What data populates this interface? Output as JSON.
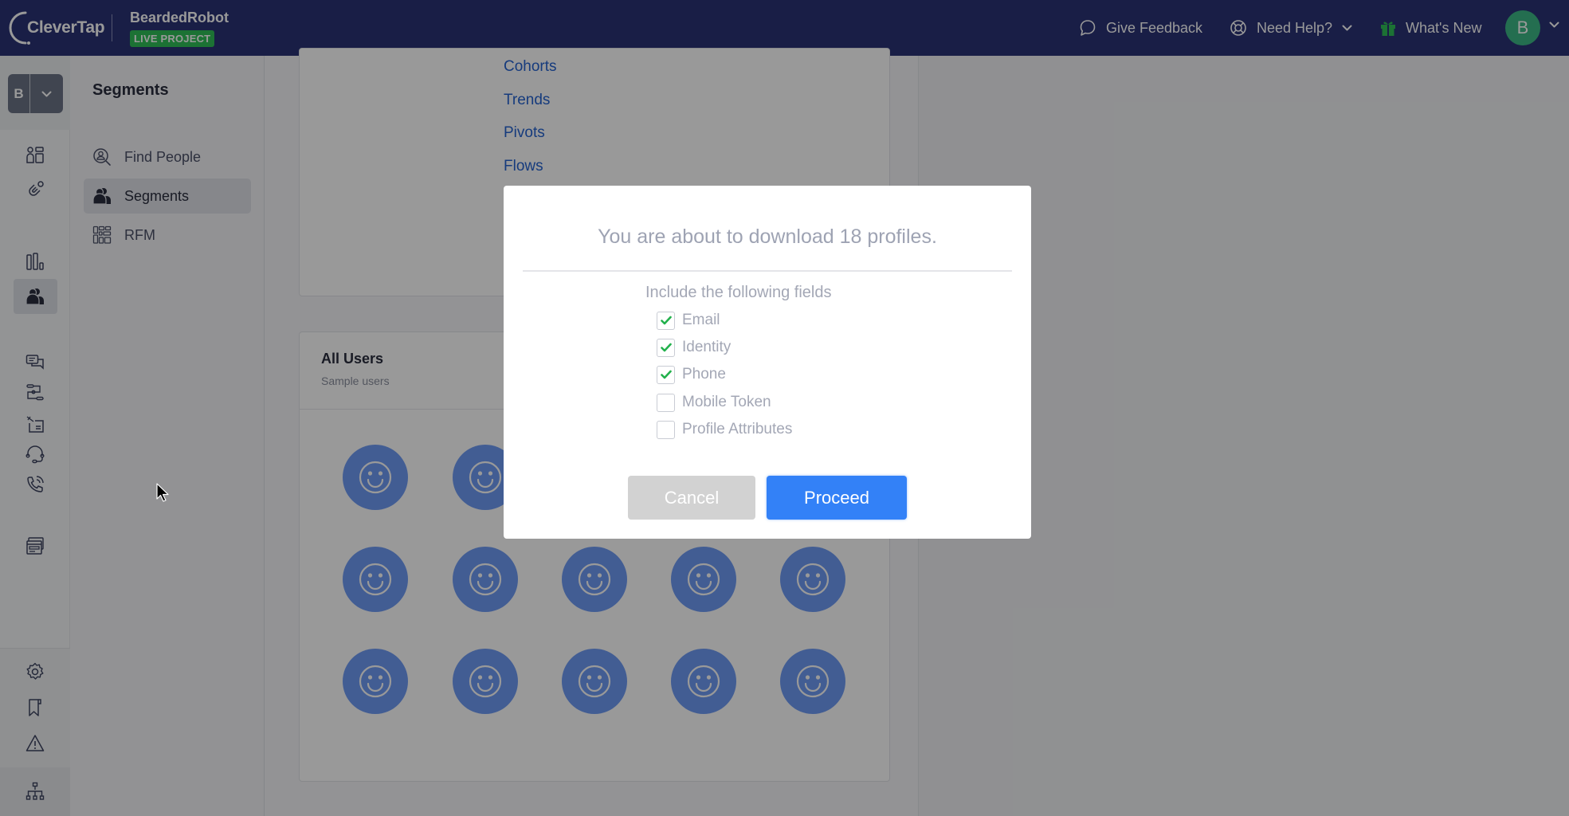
{
  "header": {
    "logo_text": "CleverTap",
    "project_name": "BeardedRobot",
    "project_badge": "LIVE PROJECT",
    "give_feedback": "Give Feedback",
    "need_help": "Need Help?",
    "whats_new": "What's New",
    "user_initial": "B"
  },
  "rail": {
    "project_initial": "B",
    "icons": [
      "dashboard-icon",
      "magnet-icon",
      "analytics-icon",
      "segments-icon",
      "messages-icon",
      "journeys-icon",
      "campaigns-icon",
      "support-icon",
      "calls-icon",
      "web-icon",
      "settings-icon",
      "bookmark-icon",
      "alert-icon",
      "hierarchy-icon"
    ],
    "active": "segments-icon"
  },
  "subnav": {
    "title": "Segments",
    "items": [
      {
        "label": "Find People",
        "icon": "find-people-icon",
        "active": false
      },
      {
        "label": "Segments",
        "icon": "segments-icon",
        "active": true
      },
      {
        "label": "RFM",
        "icon": "rfm-icon",
        "active": false
      }
    ]
  },
  "main": {
    "links": [
      "Cohorts",
      "Trends",
      "Pivots",
      "Flows"
    ],
    "users_card": {
      "title": "All Users",
      "subtitle": "Sample users",
      "avatar_count_visible": 15
    }
  },
  "modal": {
    "title": "You are about to download 18 profiles.",
    "subtitle": "Include the following fields",
    "fields": [
      {
        "label": "Email",
        "checked": true
      },
      {
        "label": "Identity",
        "checked": true
      },
      {
        "label": "Phone",
        "checked": true
      },
      {
        "label": "Mobile Token",
        "checked": false
      },
      {
        "label": "Profile Attributes",
        "checked": false
      }
    ],
    "cancel_label": "Cancel",
    "proceed_label": "Proceed"
  },
  "colors": {
    "header_bg": "#2a3275",
    "live_badge": "#2fbf57",
    "primary": "#3381f7",
    "checkmark": "#22b14c",
    "avatar_bg": "#6f9cf6"
  }
}
